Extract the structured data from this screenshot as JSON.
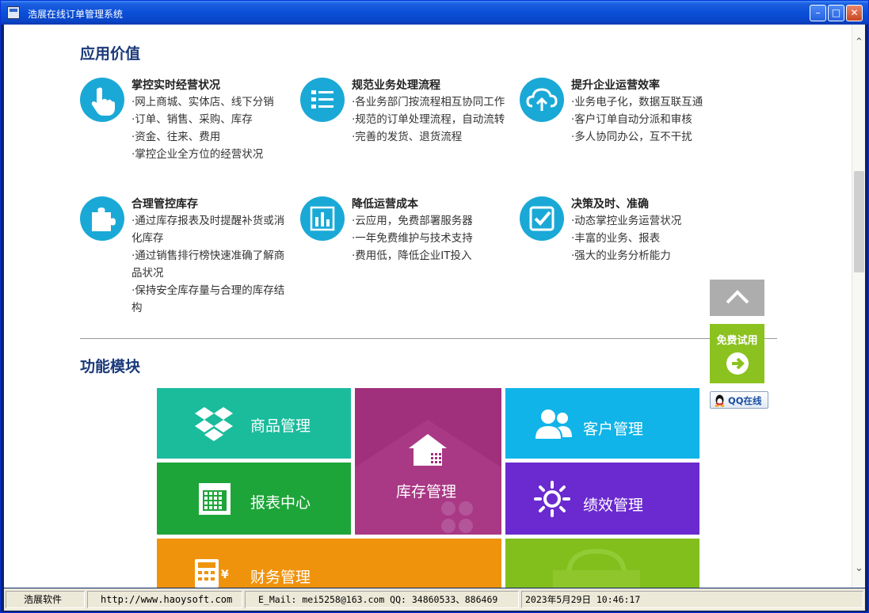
{
  "window": {
    "title": "浩展在线订单管理系统"
  },
  "value_section": {
    "title": "应用价值",
    "items": [
      {
        "icon": "hand-pointer-icon",
        "head": "掌控实时经营状况",
        "lines": [
          "·网上商城、实体店、线下分销",
          "·订单、销售、采购、库存",
          "·资金、往来、费用",
          "·掌控企业全方位的经营状况"
        ]
      },
      {
        "icon": "list-icon",
        "head": "规范业务处理流程",
        "lines": [
          "·各业务部门按流程相互协同工作",
          "·规范的订单处理流程，自动流转",
          "·完善的发货、退货流程"
        ]
      },
      {
        "icon": "cloud-upload-icon",
        "head": "提升企业运营效率",
        "lines": [
          "·业务电子化，数据互联互通",
          "·客户订单自动分派和审核",
          "·多人协同办公，互不干扰"
        ]
      },
      {
        "icon": "puzzle-icon",
        "head": "合理管控库存",
        "lines": [
          "·通过库存报表及时提醒补货或消",
          "化库存",
          "·通过销售排行榜快速准确了解商",
          "品状况",
          "·保持安全库存量与合理的库存结",
          "构"
        ]
      },
      {
        "icon": "bar-chart-icon",
        "head": "降低运营成本",
        "lines": [
          "·云应用，免费部署服务器",
          "·一年免费维护与技术支持",
          "·费用低，降低企业IT投入"
        ]
      },
      {
        "icon": "checkbox-icon",
        "head": "决策及时、准确",
        "lines": [
          "·动态掌控业务运营状况",
          "·丰富的业务、报表",
          "·强大的业务分析能力"
        ]
      }
    ]
  },
  "module_section": {
    "title": "功能模块",
    "tiles": {
      "product": {
        "label": "商品管理",
        "color": "#1abc9c",
        "icon": "dropbox-icon"
      },
      "report": {
        "label": "报表中心",
        "color": "#1ea53a",
        "icon": "calendar-grid-icon"
      },
      "inventory": {
        "label": "库存管理",
        "color": "#a0307c",
        "icon": "house-icon"
      },
      "customer": {
        "label": "客户管理",
        "color": "#10b4e8",
        "icon": "users-icon"
      },
      "performance": {
        "label": "绩效管理",
        "color": "#6a2ad0",
        "icon": "sun-icon"
      },
      "finance": {
        "label": "财务管理",
        "color": "#f0930c",
        "icon": "calculator-icon"
      },
      "extra": {
        "color": "#82bf1c"
      }
    }
  },
  "floating": {
    "up_icon": "chevron-up-icon",
    "trial_label": "免费试用",
    "trial_icon": "arrow-right-circle-icon",
    "qq_label": "QQ在线"
  },
  "status": {
    "company": "浩展软件",
    "website": "http://www.haoysoft.com",
    "contact": "E_Mail: mei5258@163.com  QQ: 34860533、886469",
    "datetime": "2023年5月29日  10:46:17"
  }
}
